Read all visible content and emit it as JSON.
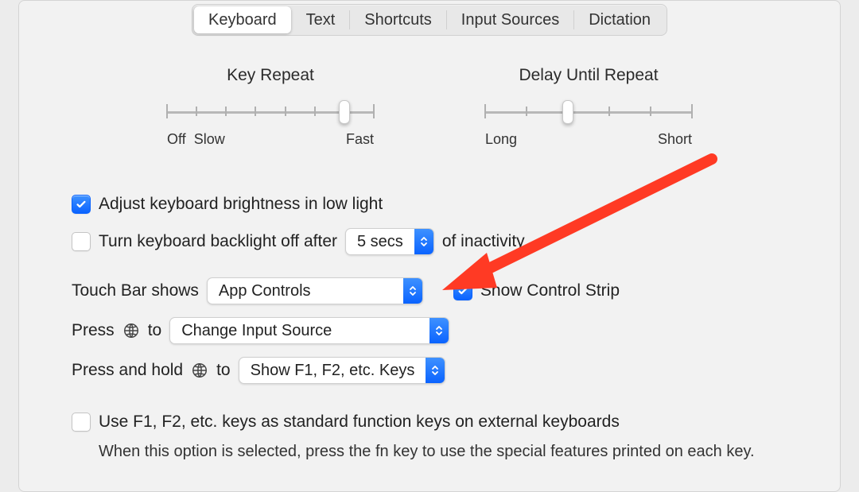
{
  "tabs": {
    "keyboard": "Keyboard",
    "text": "Text",
    "shortcuts": "Shortcuts",
    "input_sources": "Input Sources",
    "dictation": "Dictation",
    "selected": "keyboard"
  },
  "key_repeat": {
    "title": "Key Repeat",
    "left_label_off": "Off",
    "left_label_slow": "Slow",
    "right_label": "Fast",
    "ticks": 8,
    "value_index": 6
  },
  "delay_until_repeat": {
    "title": "Delay Until Repeat",
    "left_label": "Long",
    "right_label": "Short",
    "ticks": 6,
    "value_index": 2
  },
  "adjust_brightness": {
    "checked": true,
    "label": "Adjust keyboard brightness in low light"
  },
  "backlight_off": {
    "checked": false,
    "label_before": "Turn keyboard backlight off after",
    "value": "5 secs",
    "label_after": "of inactivity"
  },
  "touch_bar": {
    "label": "Touch Bar shows",
    "value": "App Controls",
    "show_control_strip_checked": true,
    "show_control_strip_label": "Show Control Strip"
  },
  "press_globe": {
    "label_before": "Press",
    "label_after": "to",
    "value": "Change Input Source"
  },
  "press_hold_globe": {
    "label_before": "Press and hold",
    "label_after": "to",
    "value": "Show F1, F2, etc. Keys"
  },
  "fn_keys": {
    "checked": false,
    "label": "Use F1, F2, etc. keys as standard function keys on external keyboards",
    "hint": "When this option is selected, press the fn key to use the special features printed on each key."
  },
  "colors": {
    "accent": "#0a63ff",
    "annotation": "#ff3a24"
  }
}
